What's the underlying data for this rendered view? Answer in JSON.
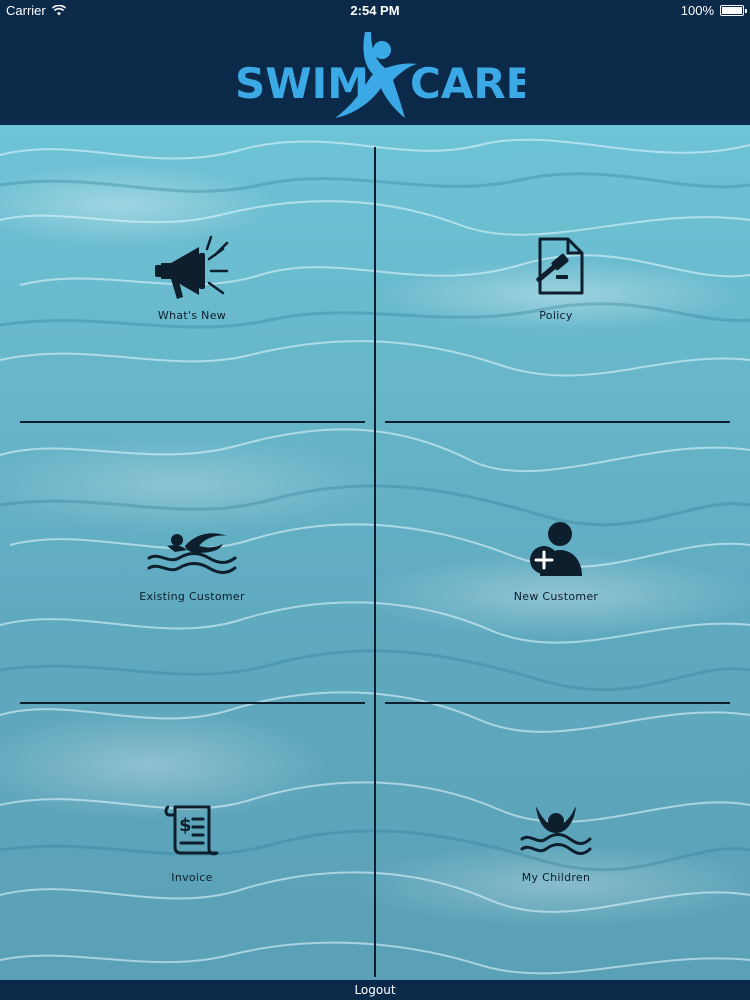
{
  "status_bar": {
    "carrier": "Carrier",
    "time": "2:54 PM",
    "battery": "100%",
    "battery_level": 1.0
  },
  "header": {
    "logo_left": "SWIM",
    "logo_right": "CARE"
  },
  "tiles": [
    {
      "label": "What's New",
      "icon": "megaphone-icon"
    },
    {
      "label": "Policy",
      "icon": "policy-document-icon"
    },
    {
      "label": "Existing Customer",
      "icon": "swimmer-icon"
    },
    {
      "label": "New Customer",
      "icon": "add-user-icon"
    },
    {
      "label": "Invoice",
      "icon": "invoice-icon"
    },
    {
      "label": "My Children",
      "icon": "child-swimmer-icon"
    }
  ],
  "footer": {
    "logout_label": "Logout"
  },
  "colors": {
    "navy": "#0b2a4a",
    "logo_blue": "#3aa9e6",
    "icon_dark": "#0d1e2c",
    "water": "#66b4c8"
  }
}
